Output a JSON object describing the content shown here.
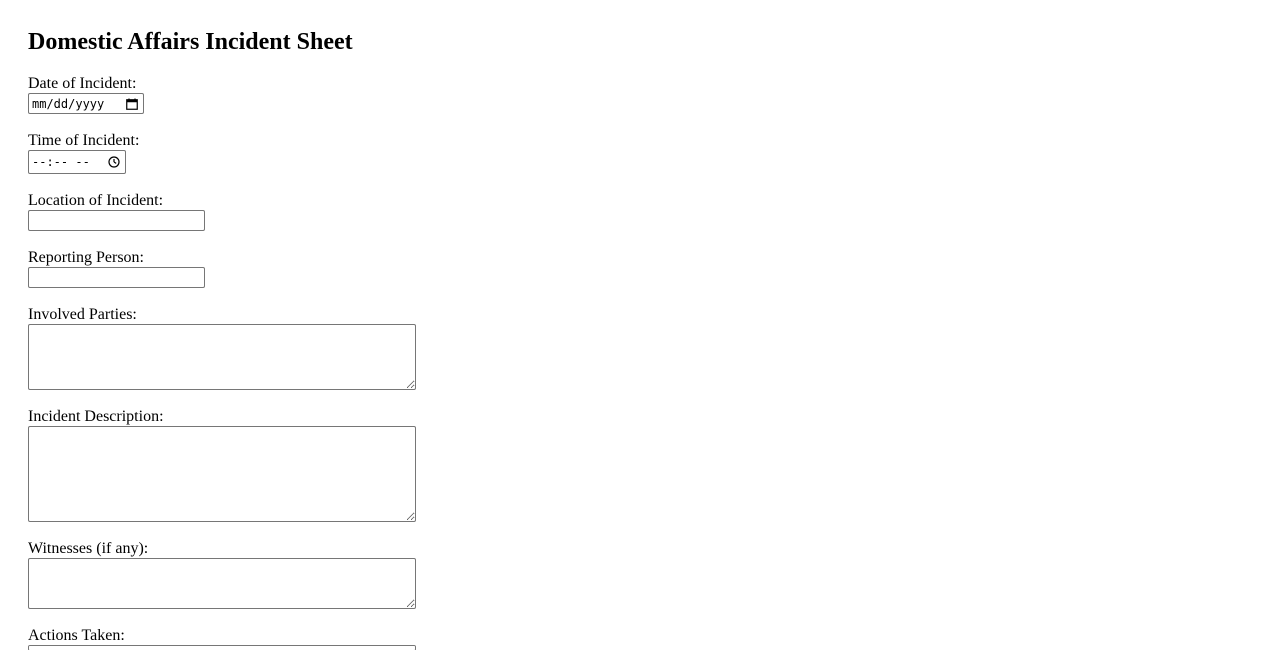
{
  "form": {
    "title": "Domestic Affairs Incident Sheet",
    "date": {
      "label": "Date of Incident:",
      "placeholder": "mm/dd/yyyy",
      "icon": "calendar-icon"
    },
    "time": {
      "label": "Time of Incident:",
      "placeholder": "--:-- --",
      "icon": "clock-icon"
    },
    "location": {
      "label": "Location of Incident:",
      "value": ""
    },
    "reporting_person": {
      "label": "Reporting Person:",
      "value": ""
    },
    "involved_parties": {
      "label": "Involved Parties:",
      "value": ""
    },
    "incident_description": {
      "label": "Incident Description:",
      "value": ""
    },
    "witnesses": {
      "label": "Witnesses (if any):",
      "value": ""
    },
    "actions_taken": {
      "label": "Actions Taken:",
      "value": ""
    }
  },
  "colors": {
    "field_border": "#767676",
    "background": "#ffffff",
    "text": "#000000"
  }
}
